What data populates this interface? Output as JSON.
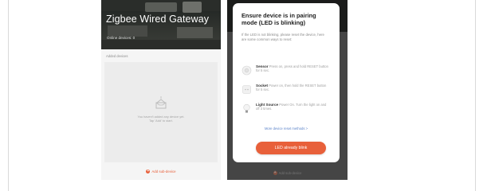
{
  "left_screen": {
    "title": "Zigbee Wired Gateway",
    "online_devices": "Online devices: 0",
    "section_label": "Added devices",
    "empty_state_line1": "You haven't added any device yet.",
    "empty_state_line2": "Tap 'Add' to start.",
    "add_subdevice": "Add sub-device",
    "add_icon_glyph": "+"
  },
  "dialog": {
    "title": "Ensure device is in pairing mode (LED is blinking)",
    "description": "If the LED is not blinking, please reset the device, here are some common ways to reset:",
    "devices": [
      {
        "name": "Sensor",
        "hint": "Press on, press and hold RESET button for 5 sec.",
        "icon": "sensor-icon"
      },
      {
        "name": "Socket",
        "hint": "Power on, then hold the RESET button for 5 sec.",
        "icon": "socket-icon"
      },
      {
        "name": "Light Source",
        "hint": "Power On. Turn the light on and off 3 times.",
        "icon": "bulb-icon"
      }
    ],
    "more_link": "More device reset methods >",
    "primary_button": "LED already blink"
  },
  "background": {
    "add_subdevice": "Add sub-device",
    "add_icon_glyph": "+"
  },
  "colors": {
    "accent": "#e8603a",
    "link": "#5b83c9"
  }
}
